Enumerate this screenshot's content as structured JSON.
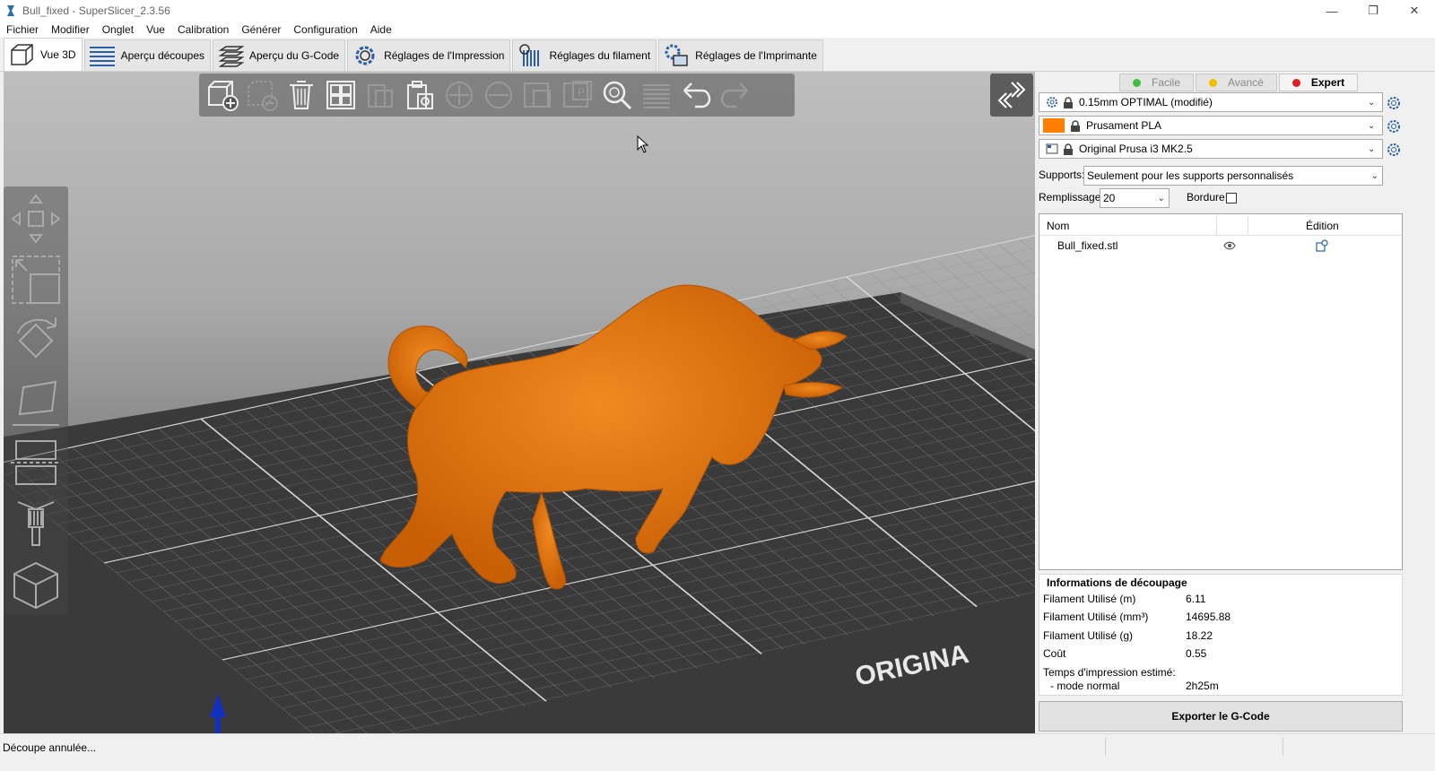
{
  "window": {
    "title": "Bull_fixed - SuperSlicer_2.3.56",
    "controls": [
      "minimize-icon",
      "restore-icon",
      "close-icon"
    ]
  },
  "menu": [
    "Fichier",
    "Modifier",
    "Onglet",
    "Vue",
    "Calibration",
    "Générer",
    "Configuration",
    "Aide"
  ],
  "tabs": [
    {
      "label": "Vue 3D",
      "icon": "cube-icon",
      "active": true
    },
    {
      "label": "Aperçu découpes",
      "icon": "layers-preview-icon",
      "active": false
    },
    {
      "label": "Aperçu du G-Code",
      "icon": "gcode-preview-icon",
      "active": false
    },
    {
      "label": "Réglages de l'Impression",
      "icon": "print-settings-gear-icon",
      "active": false
    },
    {
      "label": "Réglages du filament",
      "icon": "filament-settings-icon",
      "active": false
    },
    {
      "label": "Réglages de l'Imprimante",
      "icon": "printer-settings-icon",
      "active": false
    }
  ],
  "viewport": {
    "toolbar_icons": [
      "add-icon",
      "delete-icon",
      "delete-all-icon",
      "arrange-icon",
      "copy-icon",
      "paste-icon",
      "add-instance-icon",
      "remove-instance-icon",
      "split-objects-icon",
      "split-parts-icon",
      "search-icon",
      "layers-editing-icon",
      "undo-icon",
      "redo-icon"
    ],
    "left_tools": [
      "move-icon",
      "scale-icon",
      "rotate-icon",
      "place-on-face-icon",
      "cut-icon",
      "paint-supports-icon",
      "paint-seam-icon"
    ],
    "bed_label": "ORIGINA",
    "model_color": "#e0700a"
  },
  "mode": {
    "buttons": [
      {
        "label": "Facile",
        "color": "#3fbf3f",
        "active": false
      },
      {
        "label": "Avancé",
        "color": "#f0c000",
        "active": false
      },
      {
        "label": "Expert",
        "color": "#e02020",
        "active": true
      }
    ]
  },
  "presets": {
    "print": "0.15mm OPTIMAL (modifié)",
    "filament": "Prusament PLA",
    "filament_color": "#ff8000",
    "printer": "Original Prusa i3 MK2.5"
  },
  "settings": {
    "supports_label": "Supports:",
    "supports_value": "Seulement pour les supports personnalisés",
    "infill_label": "Remplissage:",
    "infill_value": "20",
    "brim_label": "Bordure:"
  },
  "object_list": {
    "col_name": "Nom",
    "col_edit": "Édition",
    "rows": [
      {
        "name": "Bull_fixed.stl"
      }
    ]
  },
  "slice_info": {
    "title": "Informations de découpage",
    "rows": [
      {
        "label": "Filament Utilisé (m)",
        "value": "6.11"
      },
      {
        "label": "Filament Utilisé (mm³)",
        "value": "14695.88"
      },
      {
        "label": "Filament Utilisé (g)",
        "value": "18.22"
      },
      {
        "label": "Coût",
        "value": "0.55"
      },
      {
        "label": "Temps d'impression estimé:",
        "value": ""
      },
      {
        "label": "- mode normal",
        "value": "2h25m"
      }
    ]
  },
  "export_label": "Exporter le G-Code",
  "status": "Découpe annulée..."
}
